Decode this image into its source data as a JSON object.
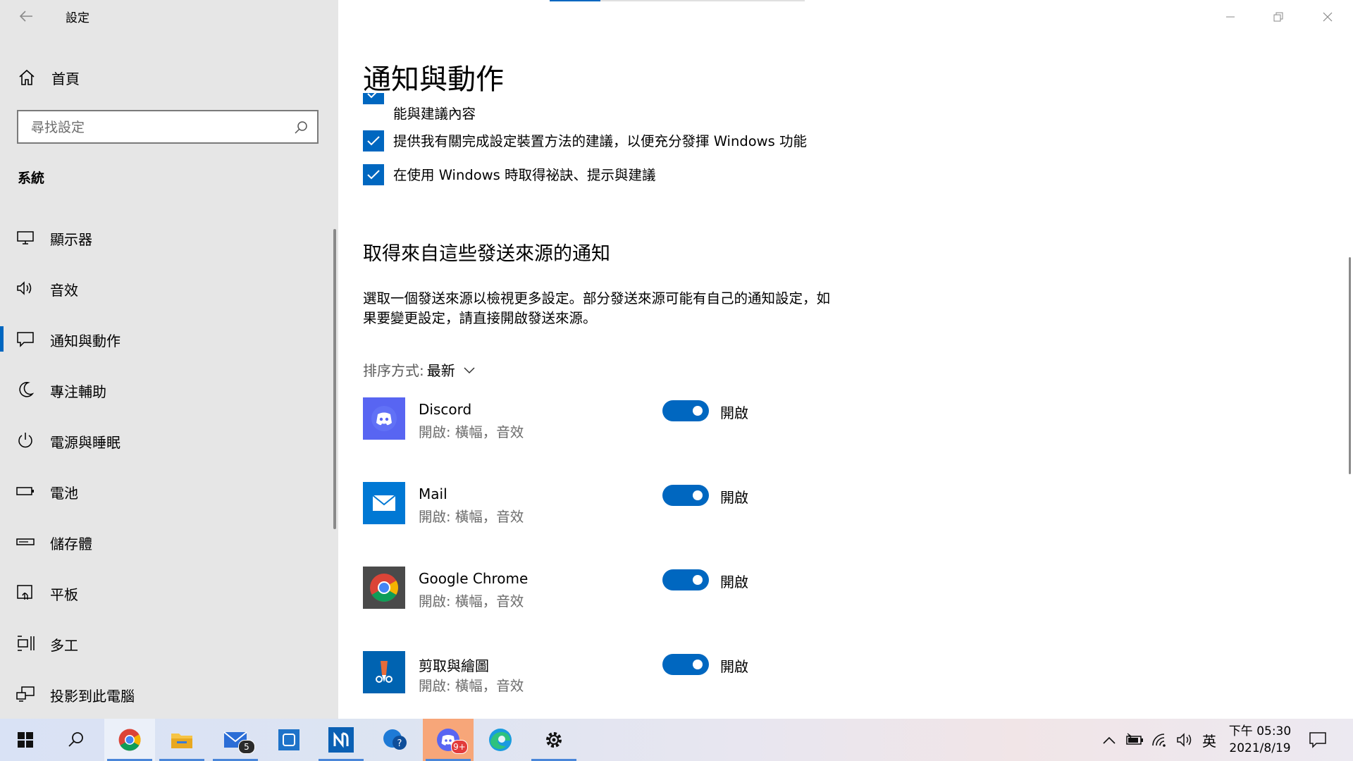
{
  "window": {
    "title": "設定"
  },
  "sidebar": {
    "home_label": "首頁",
    "search_placeholder": "尋找設定",
    "section_label": "系統",
    "items": [
      {
        "label": "顯示器",
        "icon": "monitor-icon"
      },
      {
        "label": "音效",
        "icon": "speaker-icon"
      },
      {
        "label": "通知與動作",
        "icon": "notification-icon",
        "active": true
      },
      {
        "label": "專注輔助",
        "icon": "moon-icon"
      },
      {
        "label": "電源與睡眠",
        "icon": "power-icon"
      },
      {
        "label": "電池",
        "icon": "battery-icon"
      },
      {
        "label": "儲存體",
        "icon": "storage-icon"
      },
      {
        "label": "平板",
        "icon": "tablet-icon"
      },
      {
        "label": "多工",
        "icon": "multitask-icon"
      },
      {
        "label": "投影到此電腦",
        "icon": "project-icon"
      }
    ]
  },
  "main": {
    "page_title": "通知與動作",
    "checks": [
      {
        "text": "能與建議內容",
        "checked": true
      },
      {
        "text": "提供我有關完成設定裝置方法的建議，以便充分發揮 Windows 功能",
        "checked": true
      },
      {
        "text": "在使用 Windows 時取得祕訣、提示與建議",
        "checked": true
      }
    ],
    "senders_title": "取得來自這些發送來源的通知",
    "senders_desc": "選取一個發送來源以檢視更多設定。部分發送來源可能有自己的通知設定，如果要變更設定，請直接開啟發送來源。",
    "sort_label": "排序方式:",
    "sort_value": "最新",
    "apps": [
      {
        "name": "Discord",
        "sub": "開啟: 橫幅，音效",
        "toggle": "開啟",
        "on": true,
        "color": "#5865f2"
      },
      {
        "name": "Mail",
        "sub": "開啟: 橫幅，音效",
        "toggle": "開啟",
        "on": true,
        "color": "#0078d4"
      },
      {
        "name": "Google Chrome",
        "sub": "開啟: 橫幅，音效",
        "toggle": "開啟",
        "on": true,
        "color": "#4a4a4a"
      },
      {
        "name": "剪取與繪圖",
        "sub": "開啟: 橫幅，音效",
        "toggle": "開啟",
        "on": true,
        "color": "#0063b1"
      }
    ]
  },
  "taskbar": {
    "mail_badge": "5",
    "discord_badge": "9+",
    "ime": "英",
    "time": "下午 05:30",
    "date": "2021/8/19"
  }
}
